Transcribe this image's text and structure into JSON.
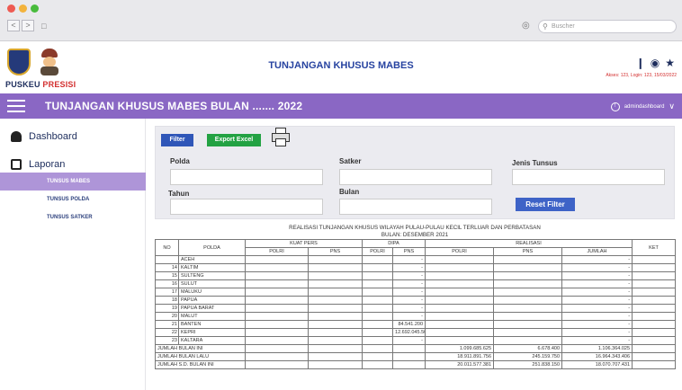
{
  "browser": {
    "search_placeholder": "Buscher",
    "back_label": "<",
    "forward_label": ">"
  },
  "header": {
    "brand_puskeu": "PUSKEU",
    "brand_presisi": "PRESISI",
    "page_title": "TUNJANGAN KHUSUS MABES",
    "access_info": "Akses: 123, Login: 123, 15/03/2022"
  },
  "topbar": {
    "title": "TUNJANGAN KHUSUS MABES BULAN ....... 2022",
    "user": "admindashboard"
  },
  "sidebar": {
    "dashboard": "Dashboard",
    "laporan": "Laporan",
    "items": [
      "TUNSUS MABES",
      "TUNSUS POLDA",
      "TUNSUS SATKER"
    ]
  },
  "filter": {
    "filter_button": "Filter",
    "export_button": "Export Excel",
    "polda_label": "Polda",
    "satker_label": "Satker",
    "jenis_label": "Jenis Tunsus",
    "tahun_label": "Tahun",
    "bulan_label": "Bulan",
    "reset_button": "Reset Filter"
  },
  "report": {
    "title": "REALISASI TUNJANGAN KHUSUS WILAYAH PULAU-PULAU KECIL TERLUAR DAN PERBATASAN",
    "subtitle": "BULAN: DESEMBER 2021",
    "headers": {
      "no": "NO",
      "polda": "POLDA",
      "kuat_pers": "KUAT PERS",
      "dipa": "DIPA",
      "realisasi": "REALISASI",
      "ket": "KET",
      "polri": "POLRI",
      "pns": "PNS",
      "jumlah": "JUMLAH"
    },
    "rows": [
      {
        "no": "1",
        "polda": "ACEH",
        "dipa_polri": "",
        "dipa_pns": "-",
        "jumlah": "-"
      },
      {
        "no": "14",
        "polda": "KALTIM",
        "dipa_polri": "",
        "dipa_pns": "-",
        "jumlah": "-"
      },
      {
        "no": "15",
        "polda": "SULTENG",
        "dipa_polri": "",
        "dipa_pns": "-",
        "jumlah": "-"
      },
      {
        "no": "16",
        "polda": "SULUT",
        "dipa_polri": "",
        "dipa_pns": "-",
        "jumlah": "-"
      },
      {
        "no": "17",
        "polda": "MALUKU",
        "dipa_polri": "",
        "dipa_pns": "-",
        "jumlah": "-"
      },
      {
        "no": "18",
        "polda": "PAPUA",
        "dipa_polri": "",
        "dipa_pns": "-",
        "jumlah": "-"
      },
      {
        "no": "19",
        "polda": "PAPUA BARAT",
        "dipa_polri": "",
        "dipa_pns": "-",
        "jumlah": "-"
      },
      {
        "no": "20",
        "polda": "MALUT",
        "dipa_polri": "",
        "dipa_pns": "-",
        "jumlah": "-"
      },
      {
        "no": "21",
        "polda": "BANTEN",
        "dipa_polri": "",
        "dipa_pns": "84.541.200",
        "jumlah": "-"
      },
      {
        "no": "22",
        "polda": "KEPRI",
        "dipa_polri": "",
        "dipa_pns": "12.692.045.500",
        "jumlah": "-"
      },
      {
        "no": "23",
        "polda": "KALTARA",
        "dipa_polri": "",
        "dipa_pns": "-",
        "jumlah": "-"
      }
    ],
    "summary": [
      {
        "label": "JUMLAH BULAN INI",
        "polri": "1.099.685.625",
        "pns": "6.678.400",
        "jumlah": "1.106.364.025"
      },
      {
        "label": "JUMLAH BULAN LALU",
        "polri": "18.911.891.756",
        "pns": "245.159.750",
        "jumlah": "16.964.343.406"
      },
      {
        "label": "JUMLAH S.D. BULAN INI",
        "polri": "20.011.577.381",
        "pns": "251.838.150",
        "jumlah": "18.070.707.431"
      }
    ]
  },
  "colors": {
    "topbar": "#8a67c4",
    "sidebar_active": "#ae95d8",
    "filter_button": "#2f56b8",
    "export_button": "#23a243",
    "reset_button": "#3e63c7",
    "title_blue": "#2743a0",
    "brand_red": "#d32f2f"
  },
  "icons": [
    "globe-icon",
    "search-icon",
    "lock-icon",
    "chat-icon",
    "bell-icon",
    "settings-icon",
    "user-icon",
    "chevron-down-icon",
    "dashboard-icon",
    "clipboard-icon",
    "printer-icon",
    "hamburger-icon"
  ]
}
